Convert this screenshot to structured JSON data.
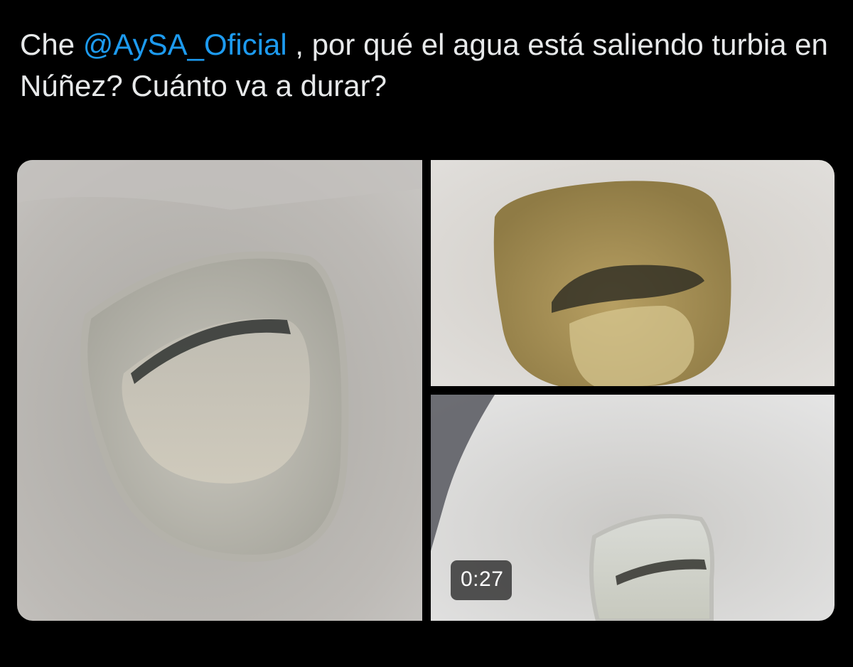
{
  "tweet": {
    "text_before": "Che ",
    "mention": "@AySA_Oficial",
    "text_after": " , por qué el agua está saliendo turbia en Núñez? Cuánto va a durar?"
  },
  "media": {
    "video_duration": "0:27",
    "tiles": [
      {
        "name": "photo-toilet-clear-water",
        "water_color": "#bdbbb5"
      },
      {
        "name": "photo-toilet-brown-water",
        "water_color": "#a08a52"
      },
      {
        "name": "video-thumbnail-toilet",
        "water_color": "#cfd0c8"
      }
    ]
  },
  "colors": {
    "background": "#000000",
    "text": "#e7e9ea",
    "mention": "#1d9bf0"
  }
}
